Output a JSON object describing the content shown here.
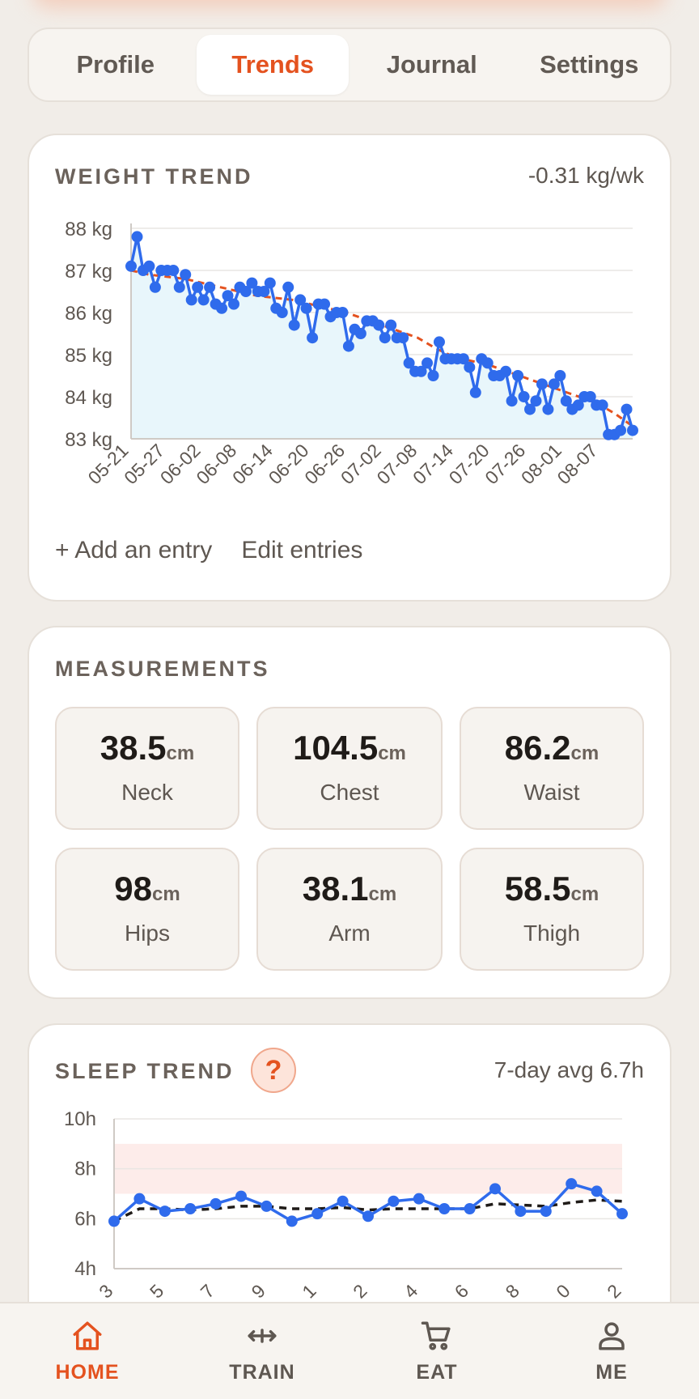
{
  "tabs": [
    {
      "label": "Profile"
    },
    {
      "label": "Trends"
    },
    {
      "label": "Journal"
    },
    {
      "label": "Settings"
    }
  ],
  "active_tab": "Trends",
  "weight": {
    "title": "WEIGHT TREND",
    "rate": "-0.31 kg/wk",
    "add_label": "+ Add an entry",
    "edit_label": "Edit entries"
  },
  "measurements": {
    "title": "MEASUREMENTS",
    "items": [
      {
        "value": "38.5",
        "unit": "cm",
        "label": "Neck"
      },
      {
        "value": "104.5",
        "unit": "cm",
        "label": "Chest"
      },
      {
        "value": "86.2",
        "unit": "cm",
        "label": "Waist"
      },
      {
        "value": "98",
        "unit": "cm",
        "label": "Hips"
      },
      {
        "value": "38.1",
        "unit": "cm",
        "label": "Arm"
      },
      {
        "value": "58.5",
        "unit": "cm",
        "label": "Thigh"
      }
    ]
  },
  "sleep": {
    "title": "SLEEP TREND",
    "help": "?",
    "avg": "7-day avg 6.7h"
  },
  "nav": [
    {
      "label": "HOME",
      "icon": "home-icon"
    },
    {
      "label": "TRAIN",
      "icon": "move-arrows-icon"
    },
    {
      "label": "EAT",
      "icon": "cart-icon"
    },
    {
      "label": "ME",
      "icon": "person-icon"
    }
  ],
  "colors": {
    "accent": "#e4521f",
    "line": "#2f6bec",
    "area": "#e8f6fb",
    "trend_dashed": "#e4521f",
    "target_band": "#fdecea"
  },
  "chart_data": [
    {
      "type": "line",
      "title": "WEIGHT TREND",
      "ylabel": "",
      "ylim": [
        83,
        88
      ],
      "y_ticks": [
        83,
        84,
        85,
        86,
        87,
        88
      ],
      "y_tick_labels": [
        "83 kg",
        "84 kg",
        "85 kg",
        "86 kg",
        "87 kg",
        "88 kg"
      ],
      "x_tick_labels": [
        "05-21",
        "05-27",
        "06-02",
        "06-08",
        "06-14",
        "06-20",
        "06-26",
        "07-02",
        "07-08",
        "07-14",
        "07-20",
        "07-26",
        "08-01",
        "08-07"
      ],
      "x_start": "05-21",
      "x_end": "08-13",
      "series": [
        {
          "values": [
            87.1,
            87.8,
            87.0,
            87.1,
            86.6,
            87.0,
            87.0,
            87.0,
            86.6,
            86.9,
            86.3,
            86.6,
            86.3,
            86.6,
            86.2,
            86.1,
            86.4,
            86.2,
            86.6,
            86.5,
            86.7,
            86.5,
            86.5,
            86.7,
            86.1,
            86.0,
            86.6,
            85.7,
            86.3,
            86.1,
            85.4,
            86.2,
            86.2,
            85.9,
            86.0,
            86.0,
            85.2,
            85.6,
            85.5,
            85.8,
            85.8,
            85.7,
            85.4,
            85.7,
            85.4,
            85.4,
            84.8,
            84.6,
            84.6,
            84.8,
            84.5,
            85.3,
            84.9,
            84.9,
            84.9,
            84.9,
            84.7,
            84.1,
            84.9,
            84.8,
            84.5,
            84.5,
            84.6,
            83.9,
            84.5,
            84.0,
            83.7,
            83.9,
            84.3,
            83.7,
            84.3,
            84.5,
            83.9,
            83.7,
            83.8,
            84.0,
            84.0,
            83.8,
            83.8,
            83.1,
            83.1,
            83.2,
            83.7,
            83.2
          ]
        },
        {
          "values": [
            87.0,
            86.9,
            86.85,
            86.8,
            86.7,
            86.6,
            86.5,
            86.4,
            86.35,
            86.3,
            86.2,
            86.1,
            86.0,
            85.85,
            85.7,
            85.55,
            85.4,
            85.15,
            84.95,
            84.85,
            84.75,
            84.6,
            84.45,
            84.3,
            84.15,
            84.0,
            83.85,
            83.6,
            83.3
          ],
          "style": "dashed"
        }
      ]
    },
    {
      "type": "line",
      "title": "SLEEP TREND",
      "ylim": [
        4,
        10
      ],
      "y_ticks": [
        4,
        6,
        8,
        10
      ],
      "y_tick_labels": [
        "4h",
        "6h",
        "8h",
        "10h"
      ],
      "x_tick_labels": [
        "3",
        "5",
        "7",
        "9",
        "1",
        "2",
        "4",
        "6",
        "8",
        "0",
        "2"
      ],
      "target_band": [
        7,
        9
      ],
      "series": [
        {
          "values": [
            5.9,
            6.8,
            6.3,
            6.4,
            6.6,
            6.9,
            6.5,
            5.9,
            6.2,
            6.7,
            6.1,
            6.7,
            6.8,
            6.4,
            6.4,
            7.2,
            6.3,
            6.3,
            7.4,
            7.1,
            6.2
          ]
        },
        {
          "values": [
            5.9,
            6.4,
            6.4,
            6.35,
            6.4,
            6.5,
            6.5,
            6.4,
            6.4,
            6.45,
            6.35,
            6.4,
            6.4,
            6.4,
            6.4,
            6.6,
            6.55,
            6.5,
            6.65,
            6.75,
            6.7
          ],
          "style": "dashed"
        }
      ]
    }
  ]
}
